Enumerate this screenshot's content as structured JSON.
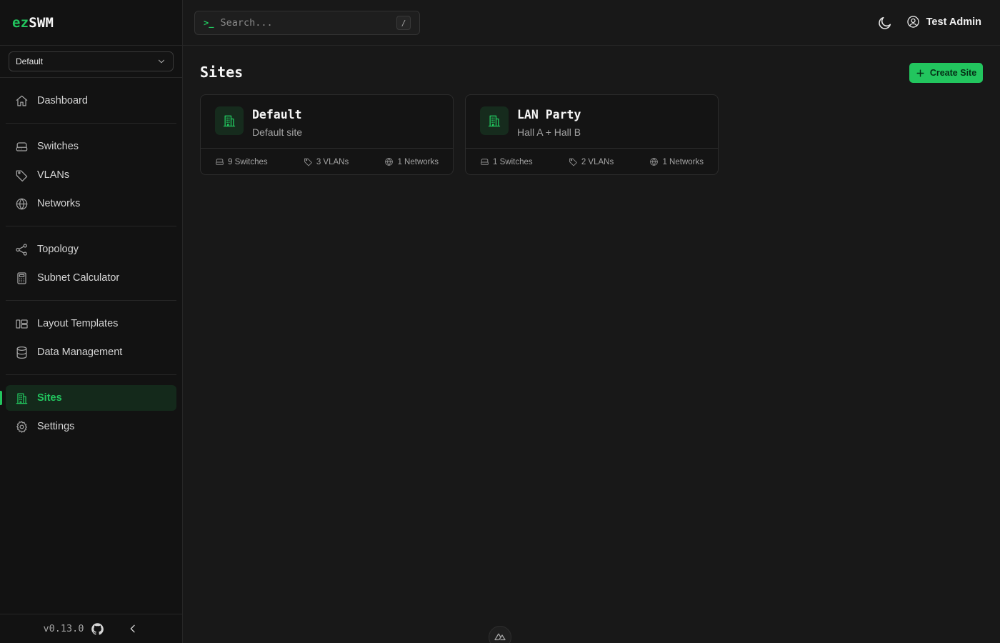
{
  "app": {
    "brand_prefix": "ez",
    "brand_suffix": "SWM",
    "version": "v0.13.0"
  },
  "site_selector": {
    "value": "Default"
  },
  "sidebar": {
    "groups": [
      [
        {
          "label": "Dashboard",
          "icon": "home-icon"
        }
      ],
      [
        {
          "label": "Switches",
          "icon": "server-icon"
        },
        {
          "label": "VLANs",
          "icon": "tag-icon"
        },
        {
          "label": "Networks",
          "icon": "globe-icon"
        }
      ],
      [
        {
          "label": "Topology",
          "icon": "share-icon"
        },
        {
          "label": "Subnet Calculator",
          "icon": "calculator-icon"
        }
      ],
      [
        {
          "label": "Layout Templates",
          "icon": "layout-icon"
        },
        {
          "label": "Data Management",
          "icon": "database-icon"
        }
      ],
      [
        {
          "label": "Sites",
          "icon": "building-icon",
          "active": true
        },
        {
          "label": "Settings",
          "icon": "gear-icon"
        }
      ]
    ]
  },
  "header": {
    "search_prompt": ">_",
    "search_placeholder": "Search...",
    "search_shortcut": "/",
    "user_name": "Test Admin"
  },
  "page": {
    "title": "Sites",
    "create_label": "Create Site"
  },
  "sites": [
    {
      "name": "Default",
      "description": "Default site",
      "switches": "9 Switches",
      "vlans": "3 VLANs",
      "networks": "1 Networks"
    },
    {
      "name": "LAN Party",
      "description": "Hall A + Hall B",
      "switches": "1 Switches",
      "vlans": "2 VLANs",
      "networks": "1 Networks"
    }
  ],
  "colors": {
    "accent": "#22c55e",
    "background": "#181818",
    "sidebar": "#121212"
  }
}
